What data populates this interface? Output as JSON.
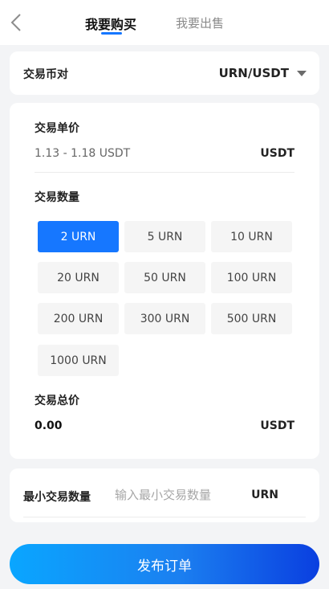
{
  "header": {
    "back_icon": "chevron-left-icon",
    "tabs": [
      {
        "label": "我要购买",
        "active": true
      },
      {
        "label": "我要出售",
        "active": false
      }
    ]
  },
  "pair": {
    "label": "交易币对",
    "value": "URN/USDT",
    "dropdown_icon": "caret-down-icon"
  },
  "price": {
    "label": "交易单价",
    "range": "1.13 - 1.18 USDT",
    "unit": "USDT"
  },
  "quantity": {
    "label": "交易数量",
    "options": [
      "2 URN",
      "5 URN",
      "10 URN",
      "20 URN",
      "50 URN",
      "100 URN",
      "200 URN",
      "300 URN",
      "500 URN",
      "1000 URN"
    ],
    "selected": "2 URN"
  },
  "total": {
    "label": "交易总价",
    "value": "0.00",
    "unit": "USDT"
  },
  "min_trade": {
    "label": "最小交易数量",
    "placeholder": "输入最小交易数量",
    "value": "",
    "unit": "URN"
  },
  "submit": {
    "label": "发布订单"
  },
  "colors": {
    "accent": "#1677ff",
    "background": "#f3f4f6",
    "button_gradient_start": "#0aa6ff",
    "button_gradient_end": "#0a3fe0"
  }
}
